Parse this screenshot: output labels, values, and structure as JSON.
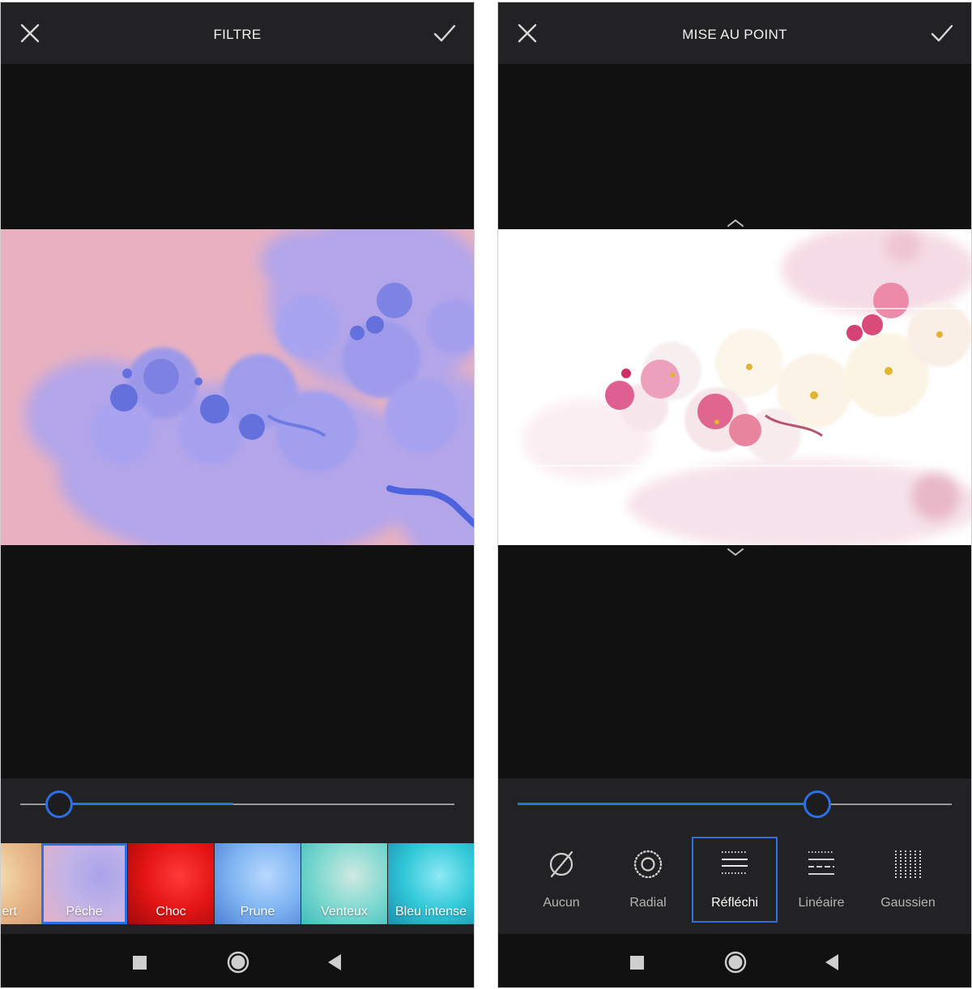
{
  "filter_screen": {
    "title": "FILTRE",
    "slider_value": 0.09,
    "filters": [
      {
        "label": "ert",
        "selected": false
      },
      {
        "label": "Pêche",
        "selected": true
      },
      {
        "label": "Choc",
        "selected": false
      },
      {
        "label": "Prune",
        "selected": false
      },
      {
        "label": "Venteux",
        "selected": false
      },
      {
        "label": "Bleu intense",
        "selected": false
      }
    ]
  },
  "focus_screen": {
    "title": "MISE AU POINT",
    "slider_value": 0.69,
    "tools": [
      {
        "label": "Aucun",
        "icon": "no-blur-icon",
        "selected": false
      },
      {
        "label": "Radial",
        "icon": "radial-icon",
        "selected": false
      },
      {
        "label": "Réfléchi",
        "icon": "mirrored-icon",
        "selected": true
      },
      {
        "label": "Linéaire",
        "icon": "linear-icon",
        "selected": false
      },
      {
        "label": "Gaussien",
        "icon": "gaussian-icon",
        "selected": false
      }
    ]
  },
  "icons": {
    "close": "close-icon",
    "confirm": "checkmark-icon",
    "nav_recents": "square-icon",
    "nav_home": "circle-icon",
    "nav_back": "triangle-back-icon"
  },
  "colors": {
    "accent": "#2f6fe4",
    "toolbar": "#222224",
    "background": "#111112"
  }
}
